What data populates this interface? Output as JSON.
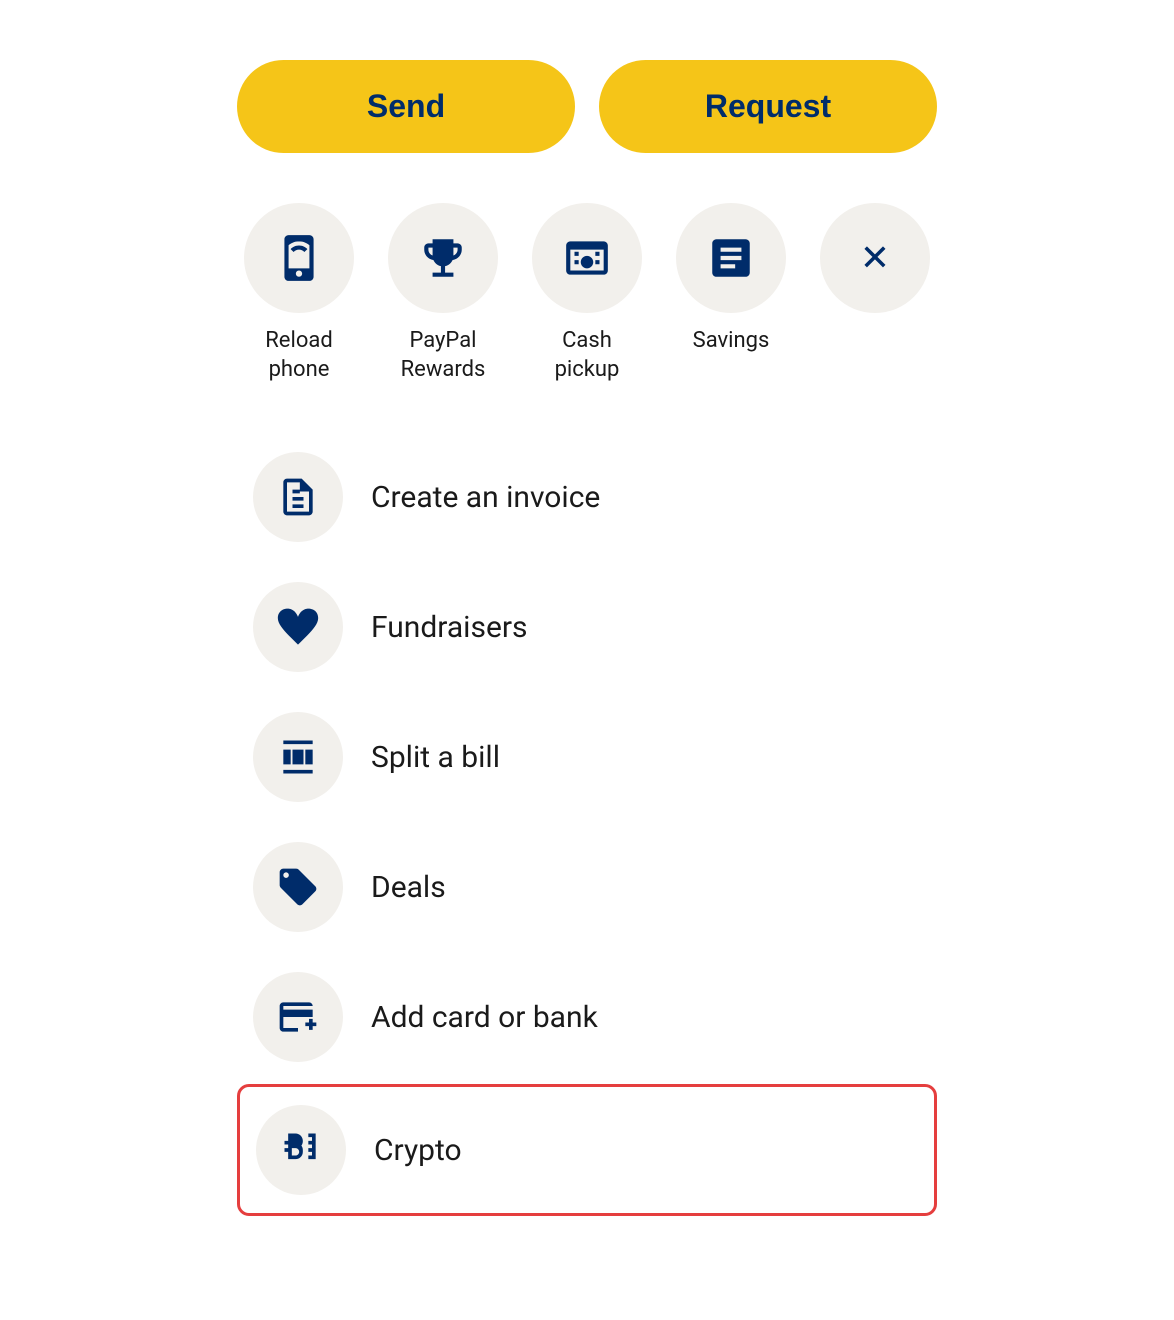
{
  "buttons": {
    "send_label": "Send",
    "request_label": "Request"
  },
  "quick_actions": [
    {
      "id": "reload-phone",
      "label": "Reload\nphone",
      "icon": "reload-phone-icon"
    },
    {
      "id": "paypal-rewards",
      "label": "PayPal\nRewards",
      "icon": "trophy-icon"
    },
    {
      "id": "cash-pickup",
      "label": "Cash\npickup",
      "icon": "cash-icon"
    },
    {
      "id": "savings",
      "label": "Savings",
      "icon": "savings-icon"
    },
    {
      "id": "close",
      "label": "",
      "icon": "close-icon"
    }
  ],
  "list_items": [
    {
      "id": "create-invoice",
      "label": "Create an invoice",
      "icon": "invoice-icon",
      "highlighted": false
    },
    {
      "id": "fundraisers",
      "label": "Fundraisers",
      "icon": "fundraisers-icon",
      "highlighted": false
    },
    {
      "id": "split-bill",
      "label": "Split a bill",
      "icon": "split-bill-icon",
      "highlighted": false
    },
    {
      "id": "deals",
      "label": "Deals",
      "icon": "deals-icon",
      "highlighted": false
    },
    {
      "id": "add-card-bank",
      "label": "Add card or bank",
      "icon": "add-card-icon",
      "highlighted": false
    },
    {
      "id": "crypto",
      "label": "Crypto",
      "icon": "crypto-icon",
      "highlighted": true
    }
  ]
}
